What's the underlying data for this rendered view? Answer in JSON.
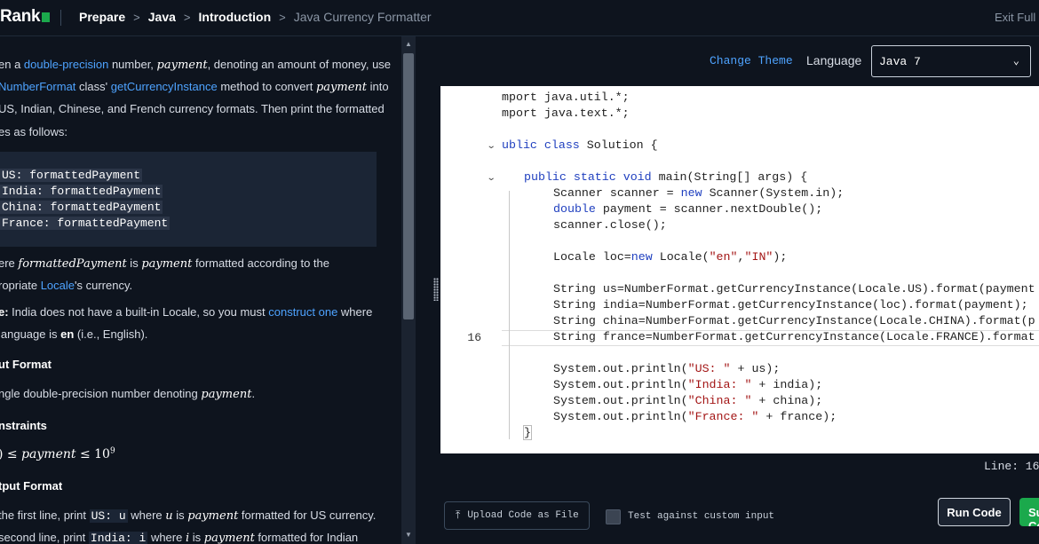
{
  "header": {
    "logo_text": "Rank",
    "breadcrumbs": [
      "Prepare",
      "Java",
      "Introduction"
    ],
    "current_page": "Java Currency Formatter",
    "exit_label": "Exit Full S"
  },
  "problem": {
    "p1_l1_a": "en a ",
    "p1_l1_link": "double-precision",
    "p1_l1_b": " number, ",
    "p1_l1_math": "payment",
    "p1_l1_c": ", denoting an amount of money, use",
    "p1_l2_link1": "NumberFormat",
    "p1_l2_b": " class' ",
    "p1_l2_link2": "getCurrencyInstance",
    "p1_l2_c": " method to convert ",
    "p1_l2_math": "payment",
    "p1_l2_d": " into",
    "p1_l3": "US, Indian, Chinese, and French currency formats. Then print the formatted",
    "p1_l4": "es as follows:",
    "sample_lines": [
      "US: formattedPayment",
      "India: formattedPayment",
      "China: formattedPayment",
      "France: formattedPayment"
    ],
    "p2_l1_a": "ere ",
    "p2_l1_math1": "formattedPayment",
    "p2_l1_b": " is ",
    "p2_l1_math2": "payment",
    "p2_l1_c": " formatted according to the",
    "p2_l2_a": "ropriate ",
    "p2_l2_link": "Locale",
    "p2_l2_b": "'s currency.",
    "note_l1_bold": "e:",
    "note_l1_a": " India does not have a built-in Locale, so you must ",
    "note_l1_link": "construct one",
    "note_l1_b": " where",
    "note_l2_a": "language is ",
    "note_l2_bold": "en",
    "note_l2_b": " (i.e., English).",
    "input_heading": "ut Format",
    "input_a": "ngle double-precision number denoting ",
    "input_math": "payment",
    "input_b": ".",
    "constraints_heading": "nstraints",
    "constraint_a": ") ≤ ",
    "constraint_math": "payment",
    "constraint_b": " ≤ 10",
    "constraint_exp": "9",
    "output_heading": "tput Format",
    "out_l1_a": " the first line, print ",
    "out_l1_code": "US: u",
    "out_l1_b": " where ",
    "out_l1_math1": "u",
    "out_l1_c": " is ",
    "out_l1_math2": "payment",
    "out_l1_d": " formatted for US currency.",
    "out_l2_a": " second line, print ",
    "out_l2_code": "India: i",
    "out_l2_b": " where ",
    "out_l2_math1": "i",
    "out_l2_c": " is ",
    "out_l2_math2": "payment",
    "out_l2_d": " formatted for Indian"
  },
  "editor_toolbar": {
    "change_theme": "Change Theme",
    "language_label": "Language",
    "language_value": "Java 7"
  },
  "editor": {
    "active_line_number": "16",
    "cursor_info": "Line: 16",
    "lines": {
      "l1": "mport java.util.*;",
      "l2": "mport java.text.*;",
      "l4_kw": "ublic class",
      "l4_rest": " Solution {",
      "l6_kw": "public static void",
      "l6_rest": " main(String[] args) {",
      "l7_a": "Scanner scanner = ",
      "l7_kw": "new",
      "l7_b": " Scanner(System.in);",
      "l8_kw": "double",
      "l8_rest": " payment = scanner.nextDouble();",
      "l9": "scanner.close();",
      "l11_a": "Locale loc=",
      "l11_kw": "new",
      "l11_b": " Locale(",
      "l11_s1": "\"en\"",
      "l11_c": ",",
      "l11_s2": "\"IN\"",
      "l11_d": ");",
      "l13": "String us=NumberFormat.getCurrencyInstance(Locale.US).format(payment",
      "l14": "String india=NumberFormat.getCurrencyInstance(loc).format(payment);",
      "l15": "String china=NumberFormat.getCurrencyInstance(Locale.CHINA).format(p",
      "l16": "String france=NumberFormat.getCurrencyInstance(Locale.FRANCE).format",
      "l18_a": "System.out.println(",
      "l18_s": "\"US: \"",
      "l18_b": " + us);",
      "l19_a": "System.out.println(",
      "l19_s": "\"India: \"",
      "l19_b": " + india);",
      "l20_a": "System.out.println(",
      "l20_s": "\"China: \"",
      "l20_b": " + china);",
      "l21_a": "System.out.println(",
      "l21_s": "\"France: \"",
      "l21_b": " + france);",
      "l22": "}"
    }
  },
  "footer": {
    "upload_label": "Upload Code as File",
    "custom_input_label": "Test against custom input",
    "run_label": "Run Code",
    "submit_label": "Submit Code"
  }
}
